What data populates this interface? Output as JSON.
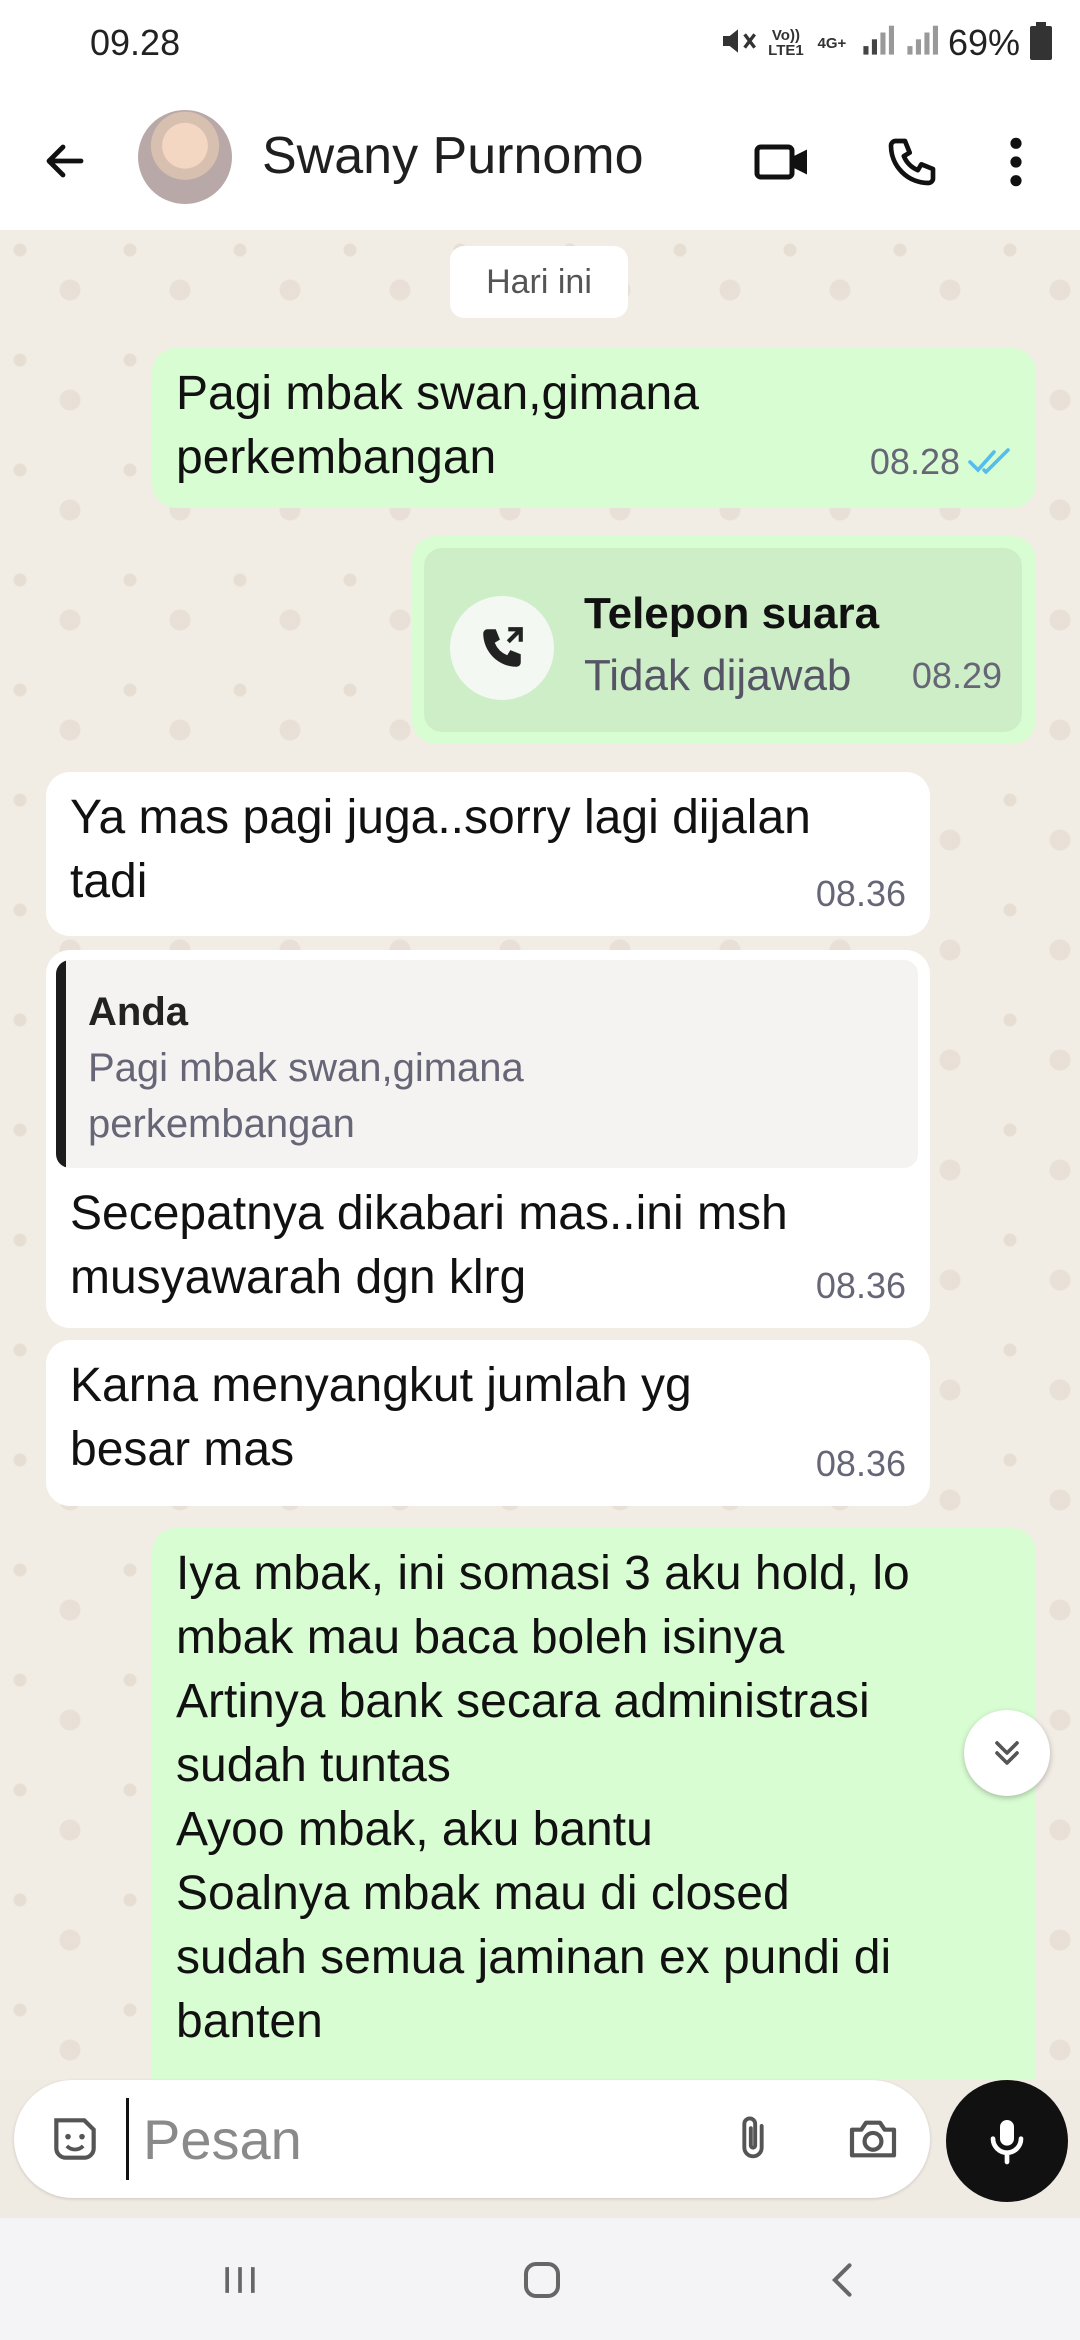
{
  "status_bar": {
    "time": "09.28",
    "volte": "Vo)) LTE1",
    "network": "4G+",
    "battery": "69%"
  },
  "header": {
    "contact_name": "Swany Purnomo"
  },
  "chat": {
    "date_divider": "Hari ini",
    "messages": [
      {
        "direction": "out",
        "text": "Pagi mbak swan,gimana\nperkembangan",
        "time": "08.28",
        "status": "read"
      },
      {
        "direction": "out",
        "type": "call",
        "title": "Telepon suara",
        "subtitle": "Tidak dijawab",
        "time": "08.29"
      },
      {
        "direction": "in",
        "text": "Ya mas pagi juga..sorry lagi dijalan\ntadi",
        "time": "08.36"
      },
      {
        "direction": "in",
        "quote": {
          "author": "Anda",
          "text": "Pagi mbak swan,gimana\nperkembangan"
        },
        "text": "Secepatnya dikabari mas..ini msh\nmusyawarah dgn klrg",
        "time": "08.36"
      },
      {
        "direction": "in",
        "text": "Karna menyangkut jumlah yg\nbesar mas",
        "time": "08.36"
      },
      {
        "direction": "out",
        "text": "Iya mbak, ini somasi 3 aku hold, lo\nmbak mau baca boleh isinya\nArtinya bank secara administrasi\nsudah tuntas\nAyoo mbak, aku bantu\nSoalnya mbak mau di closed\nsudah semua jaminan ex pundi di\nbanten"
      }
    ]
  },
  "composer": {
    "placeholder": "Pesan"
  },
  "colors": {
    "outgoing_bubble": "#d9fdd3",
    "incoming_bubble": "#ffffff",
    "read_tick": "#53bdeb",
    "mic_button": "#111111"
  }
}
